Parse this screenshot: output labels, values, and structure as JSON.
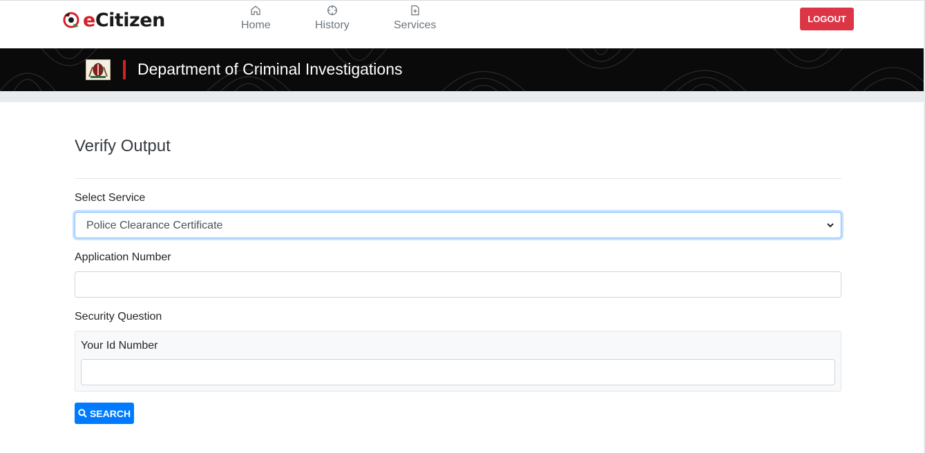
{
  "header": {
    "logo_text_e": "e",
    "logo_text_rest": "Citizen",
    "nav": [
      {
        "label": "Home",
        "icon": "home-icon"
      },
      {
        "label": "History",
        "icon": "history-icon"
      },
      {
        "label": "Services",
        "icon": "services-icon"
      }
    ],
    "logout_label": "LOGOUT"
  },
  "banner": {
    "department": "Department of Criminal Investigations",
    "seal_icon": "kenya-coat-of-arms-icon"
  },
  "form": {
    "title": "Verify Output",
    "service_label": "Select Service",
    "service_selected": "Police Clearance Certificate",
    "application_label": "Application Number",
    "application_value": "",
    "security_label": "Security Question",
    "question_label": "Your Id Number",
    "question_value": "",
    "search_label": "SEARCH"
  },
  "colors": {
    "logout": "#dc3545",
    "search": "#007bff",
    "banner": "#0a0a0a",
    "accent_red": "#d42027"
  }
}
